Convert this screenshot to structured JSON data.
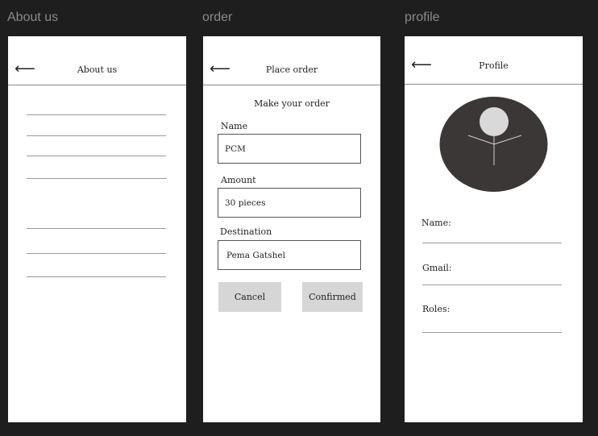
{
  "frames": {
    "about_title": "About us",
    "order_title": "order",
    "profile_title": "profile"
  },
  "about": {
    "back": "⟵",
    "header": "About us"
  },
  "order": {
    "back": "⟵",
    "header": "Place order",
    "subtitle": "Make your order",
    "name_label": "Name",
    "name_value": "PCM",
    "amount_label": "Amount",
    "amount_value": "30 pieces",
    "destination_label": "Destination",
    "destination_value": "Pema Gatshel",
    "cancel_label": "Cancel",
    "confirm_label": "Confirmed"
  },
  "profile": {
    "back": "⟵",
    "header": "Profile",
    "name_label": "Name:",
    "gmail_label": "Gmail:",
    "roles_label": "Roles:"
  },
  "colors": {
    "canvas": "#1e1e1e",
    "avatar_bg": "#3b3736",
    "avatar_head": "#d9d9d9",
    "button_bg": "#d6d6d6"
  },
  "icons": {
    "back": "back-arrow-icon",
    "avatar": "user-avatar-icon"
  }
}
